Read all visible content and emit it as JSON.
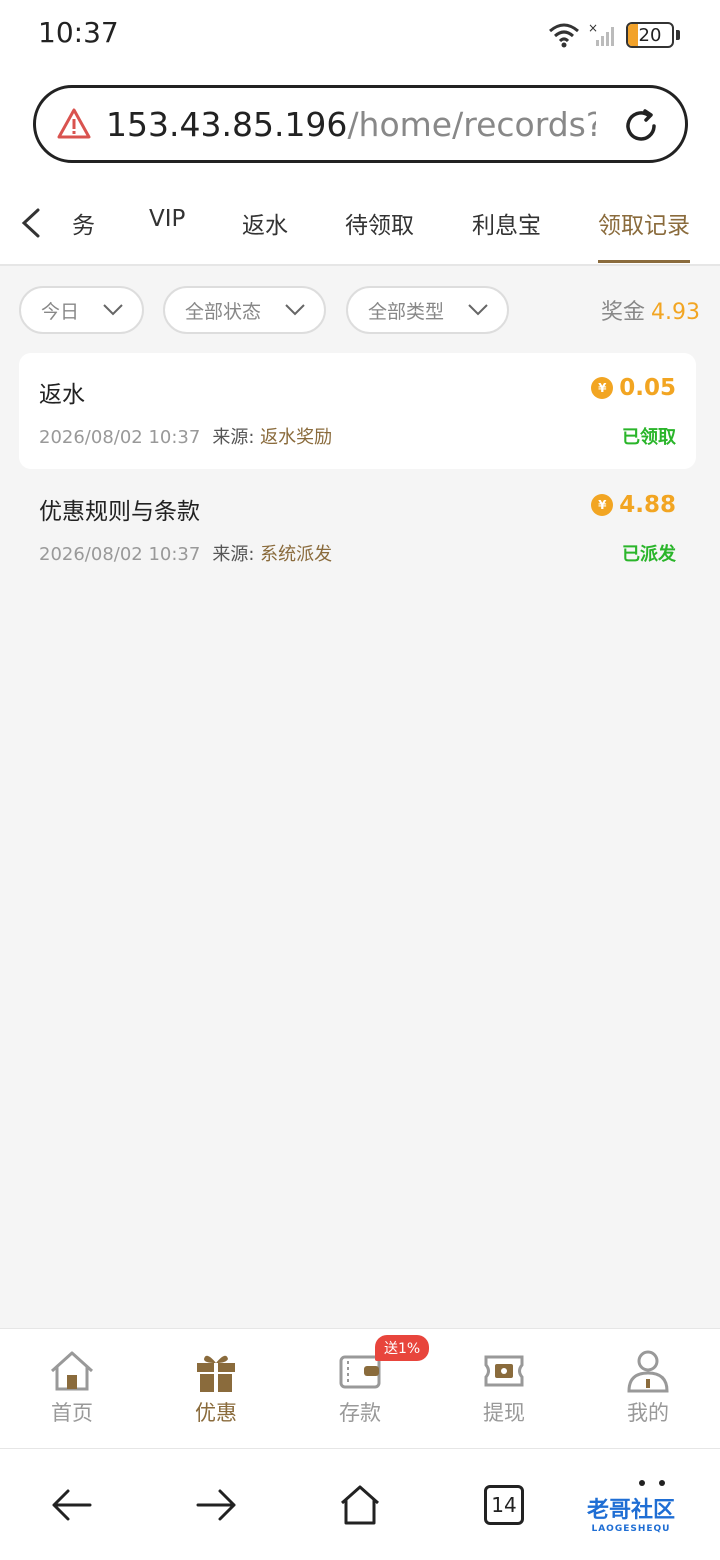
{
  "status_bar": {
    "time": "10:37",
    "battery": "20"
  },
  "browser": {
    "url_host": "153.43.85.196",
    "url_rest": "/home/records?gam",
    "tabs_count": "14"
  },
  "tabs": [
    {
      "label": "务"
    },
    {
      "label": "VIP"
    },
    {
      "label": "返水"
    },
    {
      "label": "待领取"
    },
    {
      "label": "利息宝"
    },
    {
      "label": "领取记录",
      "active": true
    }
  ],
  "filters": {
    "date": "今日",
    "status": "全部状态",
    "type": "全部类型",
    "bonus_label": "奖金",
    "bonus_value": "4.93"
  },
  "records": [
    {
      "title": "返水",
      "amount": "0.05",
      "datetime": "2026/08/02 10:37",
      "source_label": "来源:",
      "source": "返水奖励",
      "status": "已领取"
    },
    {
      "title": "优惠规则与条款",
      "amount": "4.88",
      "datetime": "2026/08/02 10:37",
      "source_label": "来源:",
      "source": "系统派发",
      "status": "已派发"
    }
  ],
  "coin_symbol": "¥",
  "app_nav": {
    "items": [
      "首页",
      "优惠",
      "存款",
      "提现",
      "我的"
    ],
    "deposit_badge": "送1%"
  },
  "watermark": {
    "title": "老哥社区",
    "sub": "LAOGESHEQU"
  },
  "colors": {
    "accent": "#8a6b3c",
    "amount": "#f2a522",
    "success": "#2ab52a",
    "badge": "#e8453c"
  }
}
